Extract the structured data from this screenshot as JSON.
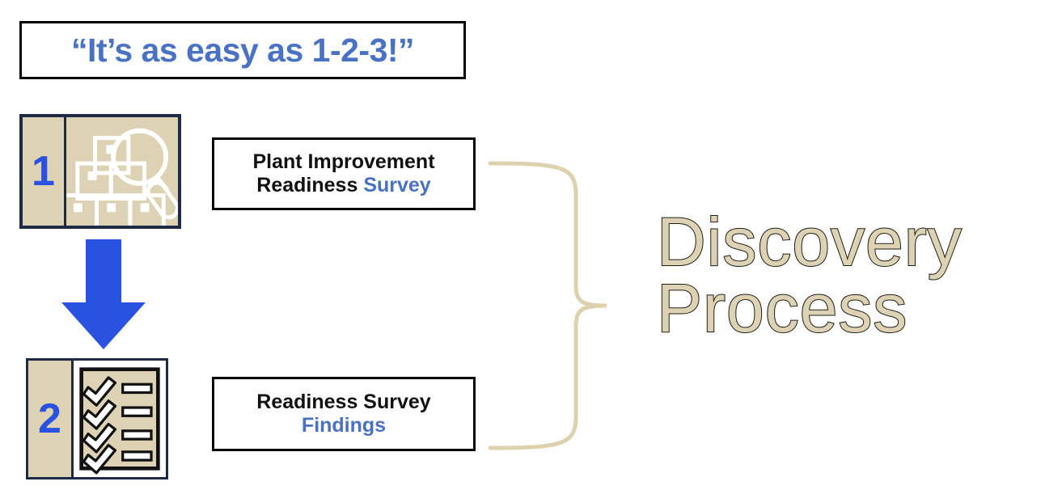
{
  "title": {
    "text": "“It’s as easy as 1-2-3!”"
  },
  "steps": [
    {
      "number": "1",
      "icon": "boxes-magnifier-icon",
      "label_lines": [
        {
          "plain": "Plant Improvement",
          "accent": ""
        },
        {
          "plain": "Readiness ",
          "accent": "Survey"
        }
      ]
    },
    {
      "number": "2",
      "icon": "checklist-icon",
      "label_lines": [
        {
          "plain": "Readiness Survey",
          "accent": ""
        },
        {
          "plain": "",
          "accent": "Findings"
        }
      ]
    }
  ],
  "labels": {
    "box1_line1": "Plant Improvement",
    "box1_line2_plain": "Readiness ",
    "box1_line2_accent": "Survey",
    "box2_line1": "Readiness Survey",
    "box2_line2_accent": "Findings"
  },
  "headline": {
    "line1": "Discovery",
    "line2": "Process"
  },
  "flow": {
    "arrow": "down-arrow-icon",
    "brace": "right-curly-brace"
  },
  "colors": {
    "accent_blue": "#4a72c4",
    "number_blue": "#2a52e0",
    "arrow_blue": "#2a52e0",
    "tan": "#ddd2b4",
    "navy_border": "#1f2a44",
    "outline_dark": "#1c1c14",
    "black": "#000000",
    "white": "#ffffff"
  }
}
